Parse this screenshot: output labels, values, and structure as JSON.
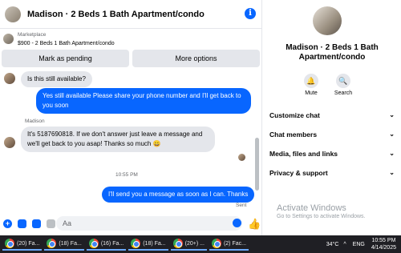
{
  "header": {
    "title": "Madison · 2 Beds 1 Bath Apartment/condo",
    "info_icon": "i"
  },
  "listing": {
    "label": "Marketplace",
    "price_line": "$900 - 2 Beds 1 Bath Apartment/condo"
  },
  "actions": {
    "pending": "Mark as pending",
    "more": "More options"
  },
  "messages": {
    "q1": "Is this still available?",
    "a1": "Yes still available Please share your phone number and I'll get back to you soon",
    "sender": "Madison",
    "q2": "It's 5187690818. If we don't answer just leave a message and we'll get back to you asap! Thanks so much 😀",
    "time": "10:55 PM",
    "a2": "I'll send you a message as soon as I can. Thanks",
    "status": "Sent"
  },
  "composer": {
    "placeholder": "Aa"
  },
  "side": {
    "name": "Madison · 2 Beds 1 Bath Apartment/condo",
    "mute": "Mute",
    "search": "Search",
    "rows": [
      "Customize chat",
      "Chat members",
      "Media, files and links",
      "Privacy & support"
    ]
  },
  "watermark": {
    "title": "Activate Windows",
    "sub": "Go to Settings to activate Windows."
  },
  "taskbar": {
    "apps": [
      "(20) Fa...",
      "(18) Fa...",
      "(16) Fa...",
      "(18) Fa...",
      "(20+) ...",
      "(2) Fac..."
    ],
    "temp": "34°C",
    "lang": "ENG",
    "time": "10:55 PM",
    "date": "4/14/2025"
  },
  "colors": {
    "accent": "#0866ff",
    "bubble_in": "#e4e6eb"
  }
}
